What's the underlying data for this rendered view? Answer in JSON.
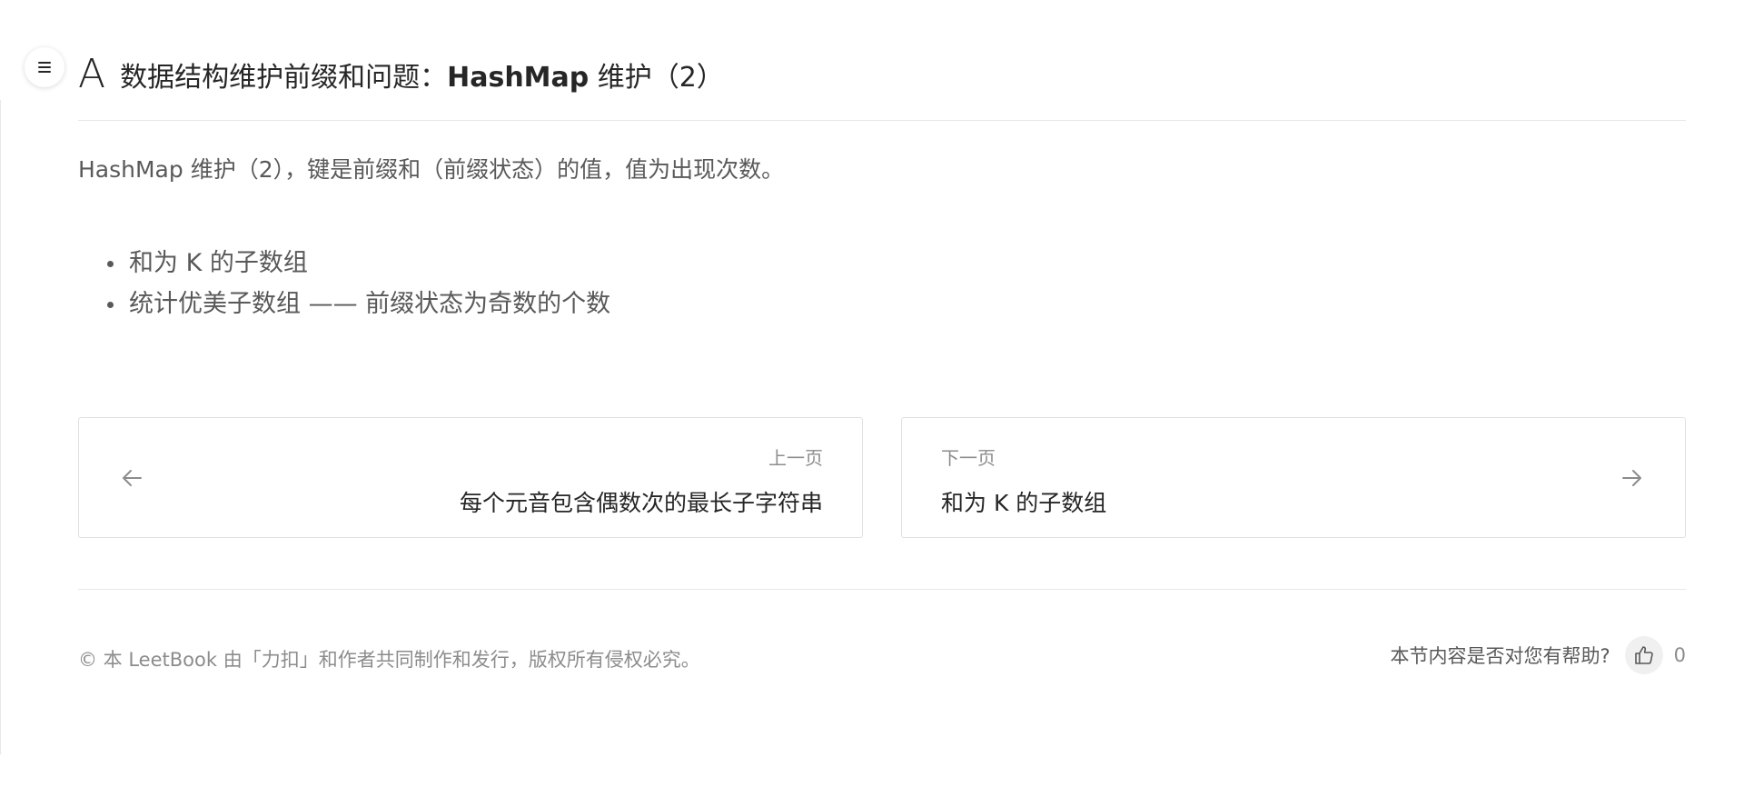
{
  "icons": {
    "menu": "menu-icon",
    "prev": "arrow-left-icon",
    "next": "arrow-right-icon",
    "like": "thumbs-up-icon"
  },
  "header": {
    "letter": "A",
    "title_prefix": "数据结构维护前缀和问题：",
    "title_bold": "HashMap",
    "title_suffix": " 维护（2）"
  },
  "main": {
    "description": "HashMap 维护（2），键是前缀和（前缀状态）的值，值为出现次数。",
    "bullets": [
      "和为 K 的子数组",
      "统计优美子数组 —— 前缀状态为奇数的个数"
    ]
  },
  "nav": {
    "prev": {
      "label": "上一页",
      "title": "每个元音包含偶数次的最长子字符串"
    },
    "next": {
      "label": "下一页",
      "title": "和为 K 的子数组"
    }
  },
  "footer": {
    "copyright": "© 本 LeetBook 由「力扣」和作者共同制作和发行，版权所有侵权必究。",
    "helpful_question": "本节内容是否对您有帮助?",
    "like_count": "0"
  }
}
